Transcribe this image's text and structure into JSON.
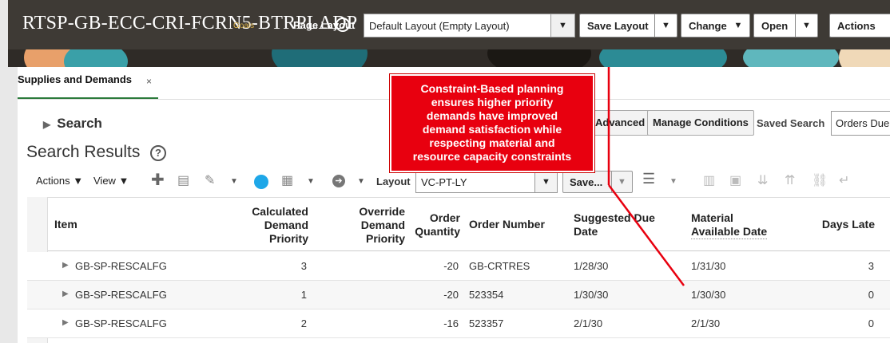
{
  "header": {
    "title": "RTSP-GB-ECC-CRI-FCRN5-BTRPLADP",
    "goals_label": "Goals",
    "page_layout_label": "Page Layout",
    "layout_value": "Default Layout (Empty Layout)",
    "buttons": {
      "save_layout": "Save Layout",
      "change": "Change",
      "open": "Open",
      "actions": "Actions"
    }
  },
  "tab": {
    "label": "Supplies and Demands",
    "close": "×"
  },
  "search": {
    "header": "Search",
    "advanced": "Advanced",
    "manage_conditions": "Manage Conditions",
    "saved_search_label": "Saved Search",
    "saved_search_value": "Orders Due"
  },
  "results": {
    "title": "Search Results",
    "help": "?"
  },
  "toolbar": {
    "actions": "Actions ▼",
    "view": "View ▼",
    "layout_label": "Layout",
    "layout_value": "VC-PT-LY",
    "save_label": "Save..."
  },
  "table": {
    "columns": {
      "item": "Item",
      "calc_priority": [
        "Calculated",
        "Demand",
        "Priority"
      ],
      "override_priority": [
        "Override",
        "Demand",
        "Priority"
      ],
      "order_qty": [
        "Order",
        "Quantity"
      ],
      "order_number": "Order Number",
      "suggested_due": [
        "Suggested Due",
        "Date"
      ],
      "material_available": [
        "Material",
        "Available Date"
      ],
      "days_late": "Days Late"
    },
    "rows": [
      {
        "item": "GB-SP-RESCALFG",
        "calc_priority": "3",
        "override_priority": "",
        "order_qty": "-20",
        "order_number": "GB-CRTRES",
        "suggested_due": "1/28/30",
        "material_available": "1/31/30",
        "days_late": "3"
      },
      {
        "item": "GB-SP-RESCALFG",
        "calc_priority": "1",
        "override_priority": "",
        "order_qty": "-20",
        "order_number": "523354",
        "suggested_due": "1/30/30",
        "material_available": "1/30/30",
        "days_late": "0"
      },
      {
        "item": "GB-SP-RESCALFG",
        "calc_priority": "2",
        "override_priority": "",
        "order_qty": "-16",
        "order_number": "523357",
        "suggested_due": "2/1/30",
        "material_available": "2/1/30",
        "days_late": "0"
      }
    ]
  },
  "callout": {
    "lines": [
      "Constraint-Based planning",
      "ensures higher priority",
      "demands have improved",
      "demand satisfaction while",
      "respecting material and",
      "resource capacity constraints"
    ],
    "color": "#e8000f"
  },
  "colors": {
    "header_bg": "#3e3a35",
    "tab_accent": "#2b7a3b",
    "status_dot": "#1ea7e8"
  }
}
